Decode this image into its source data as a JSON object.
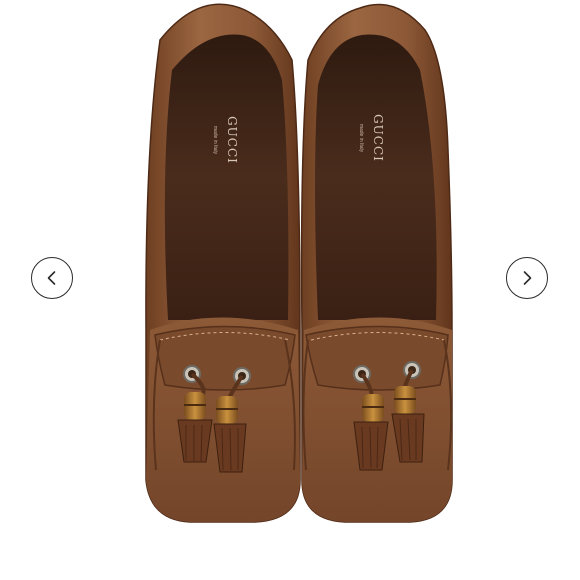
{
  "viewer": {
    "prev_label": "Previous image",
    "next_label": "Next image"
  },
  "product": {
    "brand_stamp": "GUCCI",
    "brand_sub": "made in Italy"
  },
  "colors": {
    "leather": "#8a5636",
    "leather_dark": "#5b321c",
    "insole": "#3f2519",
    "tassel": "#6a3a20",
    "bamboo": "#b07a35"
  },
  "icons": {
    "prev": "chevron-left-icon",
    "next": "chevron-right-icon"
  }
}
